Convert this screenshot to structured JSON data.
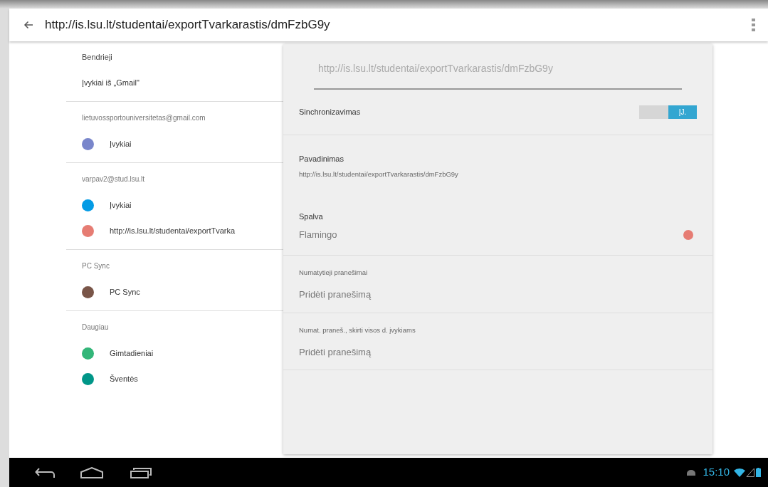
{
  "app_bar": {
    "title": "http://is.lsu.lt/studentai/exportTvarkarastis/dmFzbG9y"
  },
  "calendar_groups": [
    {
      "header": "Bendrieji",
      "items": [
        {
          "label": "Įvykiai iš „Gmail\""
        }
      ]
    },
    {
      "header": "lietuvossportouniversitetas@gmail.com",
      "items": [
        {
          "label": "Įvykiai",
          "color": "#7986cb"
        }
      ]
    },
    {
      "header": "varpav2@stud.lsu.lt",
      "items": [
        {
          "label": "Įvykiai",
          "color": "#039be5"
        },
        {
          "label": "http://is.lsu.lt/studentai/exportTvarka",
          "color": "#e67c73"
        }
      ]
    },
    {
      "header": "PC Sync",
      "items": [
        {
          "label": "PC Sync",
          "color": "#795548"
        }
      ]
    },
    {
      "header": "Daugiau",
      "items": [
        {
          "label": "Gimtadieniai",
          "color": "#33b679"
        },
        {
          "label": "Šventės",
          "color": "#009688"
        }
      ]
    }
  ],
  "details": {
    "name_field": {
      "value": "http://is.lsu.lt/studentai/exportTvarkarastis/dmFzbG9y"
    },
    "sync": {
      "label": "Sinchronizavimas",
      "toggle_label": "ĮJ.",
      "on": true
    },
    "name": {
      "label": "Pavadinimas",
      "value": "http://is.lsu.lt/studentai/exportTvarkarastis/dmFzbG9y"
    },
    "color": {
      "label": "Spalva",
      "value": "Flamingo",
      "color": "#e67c73"
    },
    "notifications": [
      {
        "label": "Numatytieji pranešimai",
        "action": "Pridėti pranešimą"
      },
      {
        "label": "Numat. praneš., skirti visos d. įvykiams",
        "action": "Pridėti pranešimą"
      }
    ]
  },
  "status_bar": {
    "time": "15:10"
  }
}
